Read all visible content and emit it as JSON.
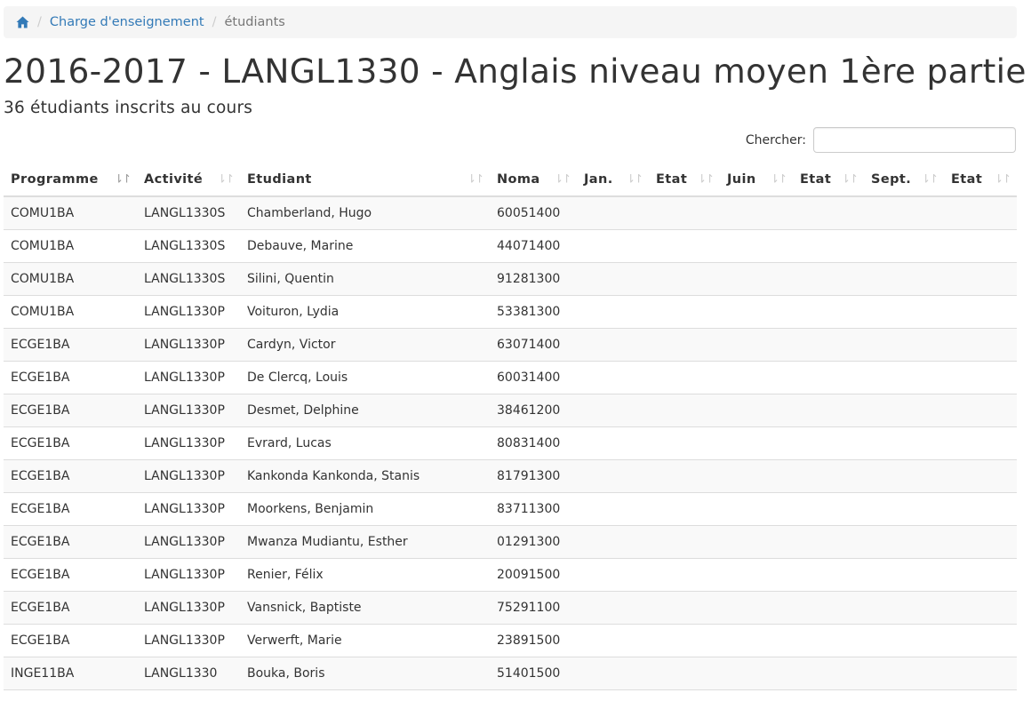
{
  "breadcrumb": {
    "home_icon": "home-icon",
    "link": "Charge d'enseignement",
    "current": "étudiants"
  },
  "page": {
    "title": "2016-2017 - LANGL1330 - Anglais niveau moyen 1ère partie",
    "subtitle": "36 étudiants inscrits au cours"
  },
  "search": {
    "label": "Chercher:",
    "value": "",
    "placeholder": ""
  },
  "table": {
    "headers": [
      "Programme",
      "Activité",
      "Etudiant",
      "Noma",
      "Jan.",
      "Etat",
      "Juin",
      "Etat",
      "Sept.",
      "Etat"
    ],
    "rows": [
      [
        "COMU1BA",
        "LANGL1330S",
        "Chamberland, Hugo",
        "60051400",
        "",
        "",
        "",
        "",
        "",
        ""
      ],
      [
        "COMU1BA",
        "LANGL1330S",
        "Debauve, Marine",
        "44071400",
        "",
        "",
        "",
        "",
        "",
        ""
      ],
      [
        "COMU1BA",
        "LANGL1330S",
        "Silini, Quentin",
        "91281300",
        "",
        "",
        "",
        "",
        "",
        ""
      ],
      [
        "COMU1BA",
        "LANGL1330P",
        "Voituron, Lydia",
        "53381300",
        "",
        "",
        "",
        "",
        "",
        ""
      ],
      [
        "ECGE1BA",
        "LANGL1330P",
        "Cardyn, Victor",
        "63071400",
        "",
        "",
        "",
        "",
        "",
        ""
      ],
      [
        "ECGE1BA",
        "LANGL1330P",
        "De Clercq, Louis",
        "60031400",
        "",
        "",
        "",
        "",
        "",
        ""
      ],
      [
        "ECGE1BA",
        "LANGL1330P",
        "Desmet, Delphine",
        "38461200",
        "",
        "",
        "",
        "",
        "",
        ""
      ],
      [
        "ECGE1BA",
        "LANGL1330P",
        "Evrard, Lucas",
        "80831400",
        "",
        "",
        "",
        "",
        "",
        ""
      ],
      [
        "ECGE1BA",
        "LANGL1330P",
        "Kankonda Kankonda, Stanis",
        "81791300",
        "",
        "",
        "",
        "",
        "",
        ""
      ],
      [
        "ECGE1BA",
        "LANGL1330P",
        "Moorkens, Benjamin",
        "83711300",
        "",
        "",
        "",
        "",
        "",
        ""
      ],
      [
        "ECGE1BA",
        "LANGL1330P",
        "Mwanza Mudiantu, Esther",
        "01291300",
        "",
        "",
        "",
        "",
        "",
        ""
      ],
      [
        "ECGE1BA",
        "LANGL1330P",
        "Renier, Félix",
        "20091500",
        "",
        "",
        "",
        "",
        "",
        ""
      ],
      [
        "ECGE1BA",
        "LANGL1330P",
        "Vansnick, Baptiste",
        "75291100",
        "",
        "",
        "",
        "",
        "",
        ""
      ],
      [
        "ECGE1BA",
        "LANGL1330P",
        "Verwerft, Marie",
        "23891500",
        "",
        "",
        "",
        "",
        "",
        ""
      ],
      [
        "INGE11BA",
        "LANGL1330",
        "Bouka, Boris",
        "51401500",
        "",
        "",
        "",
        "",
        "",
        ""
      ]
    ]
  },
  "colors": {
    "link": "#337ab7",
    "stripe": "#f9f9f9",
    "border": "#dddddd"
  }
}
